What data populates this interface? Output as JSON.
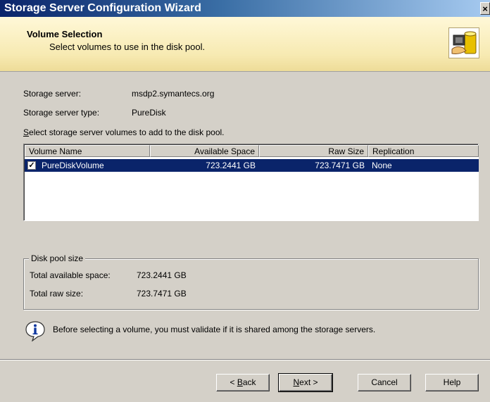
{
  "window": {
    "title": "Storage Server Configuration Wizard",
    "close_label": "×"
  },
  "header": {
    "title": "Volume Selection",
    "subtitle": "Select volumes to use in the disk pool."
  },
  "server": {
    "server_label": "Storage server:",
    "server_value": "msdp2.symantecs.org",
    "type_label": "Storage server type:",
    "type_value": "PureDisk"
  },
  "select_prompt": {
    "accel": "S",
    "rest": "elect storage server volumes to add to the disk pool."
  },
  "volumes": {
    "columns": [
      "Volume Name",
      "Available Space",
      "Raw Size",
      "Replication"
    ],
    "rows": [
      {
        "checked": true,
        "check_mark": "✓",
        "name": "PureDiskVolume",
        "available": "723.2441 GB",
        "raw": "723.7471 GB",
        "replication": "None"
      }
    ]
  },
  "disk_pool": {
    "title": "Disk pool size",
    "available_label": "Total available space:",
    "available_value": "723.2441 GB",
    "raw_label": "Total raw size:",
    "raw_value": "723.7471 GB"
  },
  "info": {
    "text": "Before selecting a volume, you must validate if it is shared among the storage servers."
  },
  "buttons": {
    "back": {
      "prefix": "< ",
      "accel": "B",
      "rest": "ack"
    },
    "next": {
      "accel": "N",
      "rest": "ext >"
    },
    "cancel": "Cancel",
    "help": "Help"
  },
  "colors": {
    "title_bar": "#0a246a",
    "selection": "#0a246a",
    "banner": "#f7eab2"
  }
}
